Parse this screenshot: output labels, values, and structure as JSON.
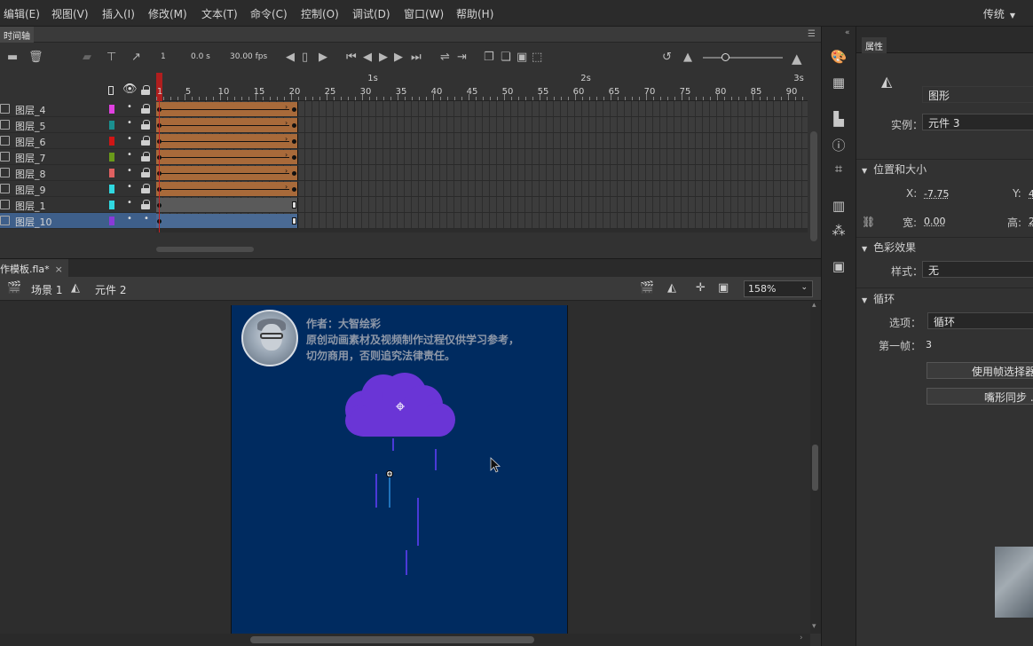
{
  "menu": {
    "items": [
      "编辑(E)",
      "视图(V)",
      "插入(I)",
      "修改(M)",
      "文本(T)",
      "命令(C)",
      "控制(O)",
      "调试(D)",
      "窗口(W)",
      "帮助(H)"
    ],
    "workspace": "传统"
  },
  "timeline": {
    "tab_label": "时间轴",
    "current_frame": "1",
    "time": "0.0 s",
    "fps": "30.00 fps",
    "ruler_numbers": [
      "1",
      "5",
      "10",
      "15",
      "20",
      "25",
      "30",
      "35",
      "40",
      "45",
      "50",
      "55",
      "60",
      "65",
      "70",
      "75",
      "80",
      "85",
      "90"
    ],
    "ruler_seconds": [
      "1s",
      "2s",
      "3s"
    ],
    "layers": [
      {
        "name": "图层_4",
        "color": "#e040e0",
        "visible_marker": "•",
        "locked": true,
        "selected": false,
        "tween": true
      },
      {
        "name": "图层_5",
        "color": "#1a8f8f",
        "visible_marker": "•",
        "locked": true,
        "selected": false,
        "tween": true
      },
      {
        "name": "图层_6",
        "color": "#d01515",
        "visible_marker": "•",
        "locked": true,
        "selected": false,
        "tween": true
      },
      {
        "name": "图层_7",
        "color": "#6a9a1a",
        "visible_marker": "•",
        "locked": true,
        "selected": false,
        "tween": true
      },
      {
        "name": "图层_8",
        "color": "#e06060",
        "visible_marker": "•",
        "locked": true,
        "selected": false,
        "tween": true
      },
      {
        "name": "图层_9",
        "color": "#30d8e0",
        "visible_marker": "•",
        "locked": true,
        "selected": false,
        "tween": true
      },
      {
        "name": "图层_1",
        "color": "#30d8e0",
        "visible_marker": "•",
        "locked": true,
        "selected": false,
        "tween": false
      },
      {
        "name": "图层_10",
        "color": "#8a3ad8",
        "visible_marker": "•",
        "locked": false,
        "selected": true,
        "tween": false
      }
    ]
  },
  "document": {
    "tab_label": "作模板.fla*",
    "close_glyph": "×",
    "scene_label": "场景 1",
    "symbol_label": "元件 2",
    "zoom": "158%"
  },
  "stage": {
    "author_line": "作者：大智绘彩",
    "notice_line1": "原创动画素材及视频制作过程仅供学习参考，",
    "notice_line2": "切勿商用，否则追究法律责任。",
    "cloud_color": "#6a35d6",
    "rain_color": "#4a3ad8"
  },
  "properties": {
    "tab_label": "属性",
    "symbol_type": "图形",
    "instance_label": "实例：",
    "instance_value": "元件 3",
    "section_position": "位置和大小",
    "x_label": "X:",
    "x_value": "-7.75",
    "y_label": "Y:",
    "y_value": "4",
    "width_label": "宽:",
    "width_value": "0.00",
    "height_label": "高:",
    "height_value": "2",
    "section_color": "色彩效果",
    "style_label": "样式：",
    "style_value": "无",
    "section_loop": "循环",
    "options_label": "选项：",
    "options_value": "循环",
    "first_frame_label": "第一帧：",
    "first_frame_value": "3",
    "btn_frame_picker": "使用帧选择器",
    "btn_lip_sync": "嘴形同步 ..."
  }
}
